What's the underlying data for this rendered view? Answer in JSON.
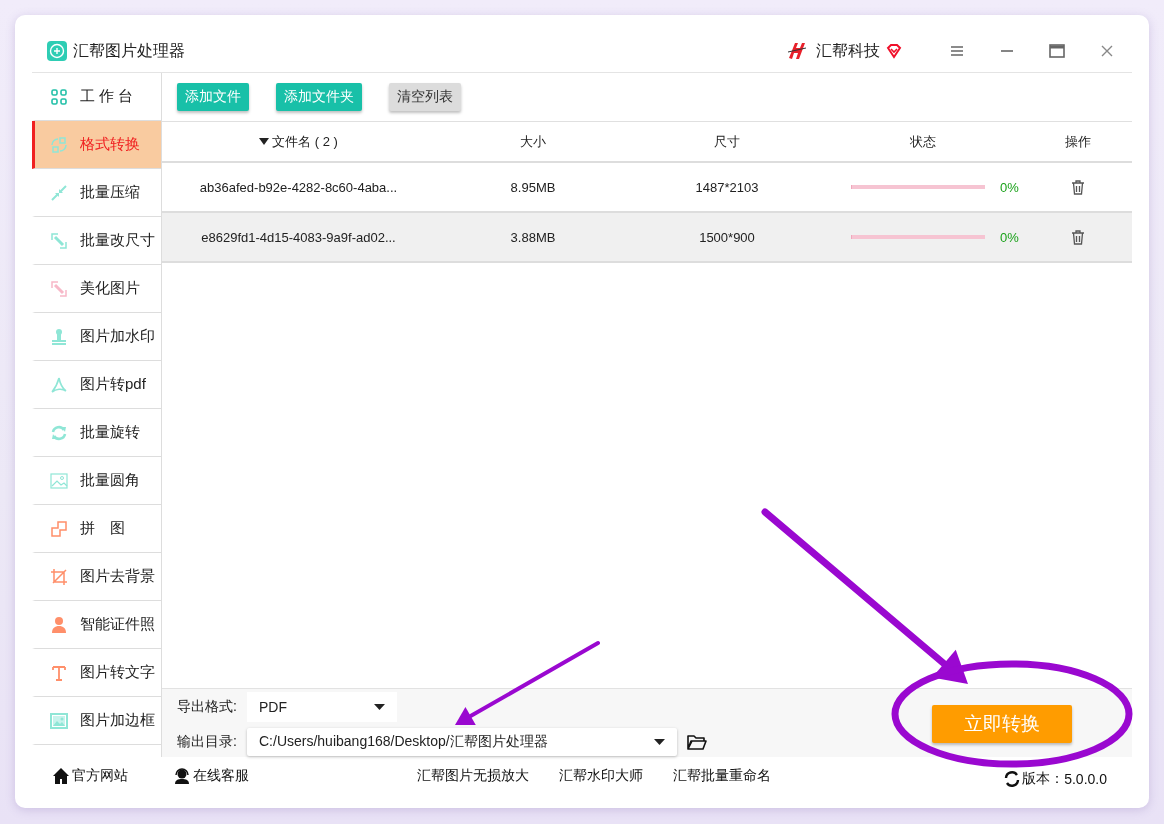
{
  "window": {
    "title": "汇帮图片处理器",
    "brand": "汇帮科技"
  },
  "sidebar": {
    "items": [
      {
        "label": "工 作 台",
        "selected": false
      },
      {
        "label": "格式转换",
        "selected": true
      },
      {
        "label": "批量压缩",
        "selected": false
      },
      {
        "label": "批量改尺寸",
        "selected": false
      },
      {
        "label": "美化图片",
        "selected": false
      },
      {
        "label": "图片加水印",
        "selected": false
      },
      {
        "label": "图片转pdf",
        "selected": false
      },
      {
        "label": "批量旋转",
        "selected": false
      },
      {
        "label": "批量圆角",
        "selected": false
      },
      {
        "label": "拼　图",
        "selected": false
      },
      {
        "label": "图片去背景",
        "selected": false
      },
      {
        "label": "智能证件照",
        "selected": false
      },
      {
        "label": "图片转文字",
        "selected": false
      },
      {
        "label": "图片加边框",
        "selected": false
      }
    ]
  },
  "toolbar": {
    "buttons": [
      {
        "label": "添加文件",
        "kind": "primary"
      },
      {
        "label": "添加文件夹",
        "kind": "primary"
      },
      {
        "label": "清空列表",
        "kind": "secondary"
      }
    ]
  },
  "table": {
    "columns": [
      {
        "label": "文件名 ( 2 )",
        "sorted": true
      },
      {
        "label": "大小",
        "sorted": false
      },
      {
        "label": "尺寸",
        "sorted": false
      },
      {
        "label": "状态",
        "sorted": false
      },
      {
        "label": "操作",
        "sorted": false
      }
    ],
    "rows": [
      {
        "name": "ab36afed-b92e-4282-8c60-4aba...",
        "size": "8.95MB",
        "dimensions": "1487*2103",
        "level": 0,
        "progress": "0%",
        "selected": false
      },
      {
        "name": "e8629fd1-4d15-4083-9a9f-ad02...",
        "size": "3.88MB",
        "dimensions": "1500*900",
        "level": 0,
        "progress": "0%",
        "selected": true
      }
    ]
  },
  "output": {
    "format_label": "导出格式:",
    "format": "PDF",
    "dir_label": "输出目录:",
    "dir": "C:/Users/huibang168/Desktop/汇帮图片处理器",
    "convert_button": "立即转换"
  },
  "footer": {
    "left": [
      {
        "label": "官方网站",
        "kind": "home"
      },
      {
        "label": "在线客服",
        "kind": "support"
      }
    ],
    "links": [
      "汇帮图片无损放大",
      "汇帮水印大师",
      "汇帮批量重命名"
    ],
    "version_label": "版本：",
    "version": "5.0.0.0"
  },
  "annotations": [
    {
      "kind": "arrow"
    },
    {
      "kind": "arrow"
    },
    {
      "kind": "ellipse"
    }
  ]
}
